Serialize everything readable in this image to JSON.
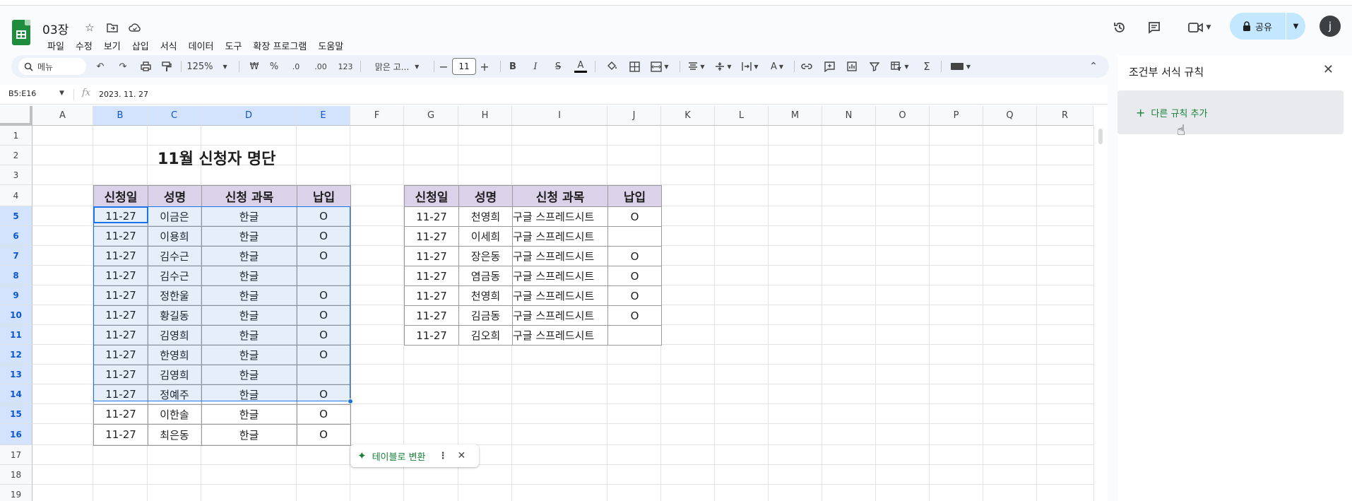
{
  "app": {
    "doc_title": "03장",
    "menus": [
      "파일",
      "수정",
      "보기",
      "삽입",
      "서식",
      "데이터",
      "도구",
      "확장 프로그램",
      "도움말"
    ],
    "share_label": "공유",
    "avatar_letter": "j"
  },
  "toolbar": {
    "search_label": "메뉴",
    "zoom": "125%",
    "currency": "₩",
    "percent": "%",
    "dec_decrease": ".0",
    "dec_increase": ".00",
    "number_format": "123",
    "font": "맑은 고...",
    "font_size": "11",
    "bold": "B",
    "italic": "I",
    "strikethrough": "S",
    "text_color": "A"
  },
  "formula_bar": {
    "name_box": "B5:E16",
    "fx": "fx",
    "value": "2023. 11. 27"
  },
  "columns": [
    "A",
    "B",
    "C",
    "D",
    "E",
    "F",
    "G",
    "H",
    "I",
    "J",
    "K",
    "L",
    "M",
    "N",
    "O",
    "P",
    "Q",
    "R"
  ],
  "rows": [
    "1",
    "2",
    "3",
    "4",
    "5",
    "6",
    "7",
    "8",
    "9",
    "10",
    "11",
    "12",
    "13",
    "14",
    "15",
    "16",
    "17",
    "18",
    "19"
  ],
  "sheet": {
    "title": "11월 신청자 명단",
    "table1": {
      "headers": [
        "신청일",
        "성명",
        "신청 과목",
        "납입"
      ],
      "rows": [
        [
          "11-27",
          "이금은",
          "한글",
          "O"
        ],
        [
          "11-27",
          "이용희",
          "한글",
          "O"
        ],
        [
          "11-27",
          "김수근",
          "한글",
          "O"
        ],
        [
          "11-27",
          "김수근",
          "한글",
          ""
        ],
        [
          "11-27",
          "정한울",
          "한글",
          "O"
        ],
        [
          "11-27",
          "황길동",
          "한글",
          "O"
        ],
        [
          "11-27",
          "김영희",
          "한글",
          "O"
        ],
        [
          "11-27",
          "한영희",
          "한글",
          "O"
        ],
        [
          "11-27",
          "김영희",
          "한글",
          ""
        ],
        [
          "11-27",
          "정예주",
          "한글",
          "O"
        ],
        [
          "11-27",
          "이한솔",
          "한글",
          "O"
        ],
        [
          "11-27",
          "최은동",
          "한글",
          "O"
        ]
      ]
    },
    "table2": {
      "headers": [
        "신청일",
        "성명",
        "신청 과목",
        "납입"
      ],
      "rows": [
        [
          "11-27",
          "천영희",
          "구글 스프레드시트",
          "O"
        ],
        [
          "11-27",
          "이세희",
          "구글 스프레드시트",
          ""
        ],
        [
          "11-27",
          "장은동",
          "구글 스프레드시트",
          "O"
        ],
        [
          "11-27",
          "염금동",
          "구글 스프레드시트",
          "O"
        ],
        [
          "11-27",
          "천영희",
          "구글 스프레드시트",
          "O"
        ],
        [
          "11-27",
          "김금동",
          "구글 스프레드시트",
          "O"
        ],
        [
          "11-27",
          "김오희",
          "구글 스프레드시트",
          ""
        ]
      ]
    }
  },
  "convert_chip": {
    "label": "테이블로 변환"
  },
  "side_panel": {
    "title": "조건부 서식 규칙",
    "add_rule": "다른 규칙 추가"
  },
  "colors": {
    "accent": "#1a73e8",
    "header_fill": "#d9d2e9",
    "share_bg": "#c2e7ff",
    "green": "#188038"
  }
}
